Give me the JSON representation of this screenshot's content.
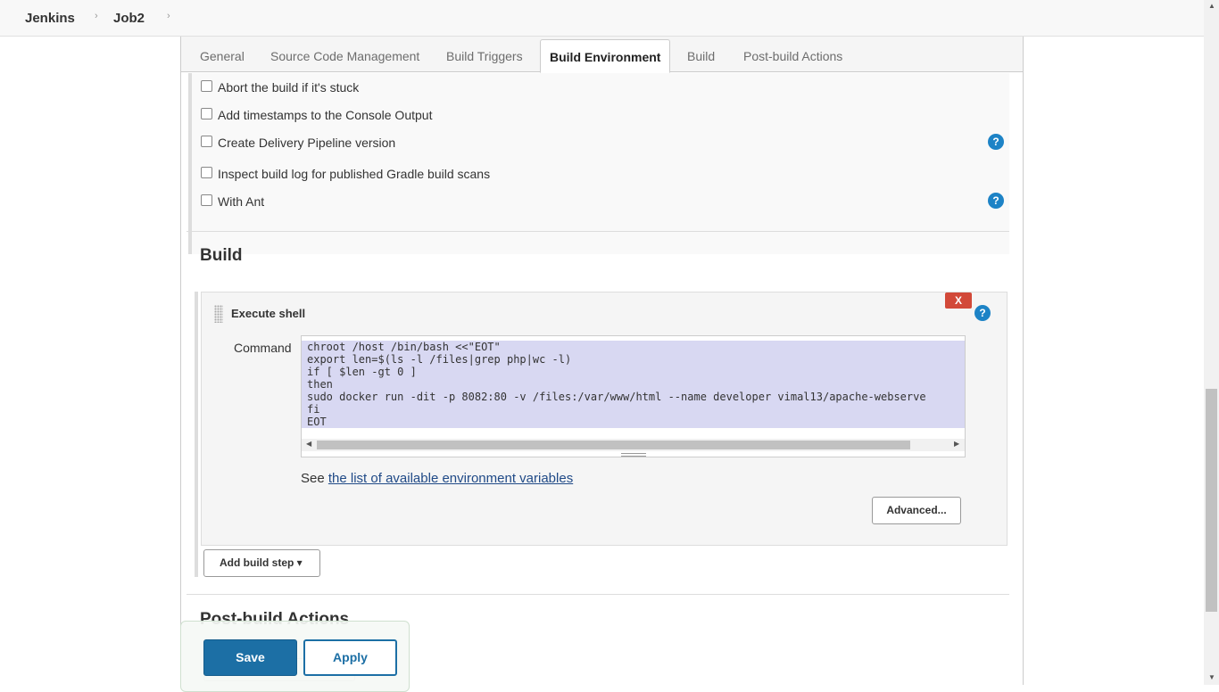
{
  "breadcrumb": {
    "items": [
      "Jenkins",
      "Job2"
    ],
    "separator": "›"
  },
  "tabs": [
    {
      "label": "General"
    },
    {
      "label": "Source Code Management"
    },
    {
      "label": "Build Triggers"
    },
    {
      "label": "Build Environment",
      "active": true
    },
    {
      "label": "Build"
    },
    {
      "label": "Post-build Actions"
    }
  ],
  "build_environment": {
    "options": [
      {
        "label": "Abort the build if it's stuck",
        "checked": false
      },
      {
        "label": "Add timestamps to the Console Output",
        "checked": false
      },
      {
        "label": "Create Delivery Pipeline version",
        "checked": false,
        "help": true
      },
      {
        "label": "Inspect build log for published Gradle build scans",
        "checked": false
      },
      {
        "label": "With Ant",
        "checked": false,
        "help": true
      }
    ],
    "help_icon": "?"
  },
  "build": {
    "title": "Build",
    "step": {
      "title": "Execute shell",
      "delete_label": "X",
      "command_label": "Command",
      "command_lines": [
        "chroot /host /bin/bash <<\"EOT\"",
        "export len=$(ls -l /files|grep php|wc -l)",
        "if [ $len -gt 0 ]",
        "then",
        "sudo docker run -dit -p 8082:80 -v /files:/var/www/html --name developer vimal13/apache-webserve",
        "fi",
        "EOT"
      ],
      "see_prefix": "See",
      "env_link": "the list of available environment variables",
      "advanced_label": "Advanced..."
    },
    "add_step_label": "Add build step",
    "add_step_caret": "▾"
  },
  "post_build": {
    "title": "Post-build Actions"
  },
  "footer": {
    "save_label": "Save",
    "apply_label": "Apply"
  },
  "colors": {
    "primary": "#1c6fa5",
    "help": "#1d83c6",
    "danger": "#d24939",
    "selection": "#d8d8f2"
  }
}
